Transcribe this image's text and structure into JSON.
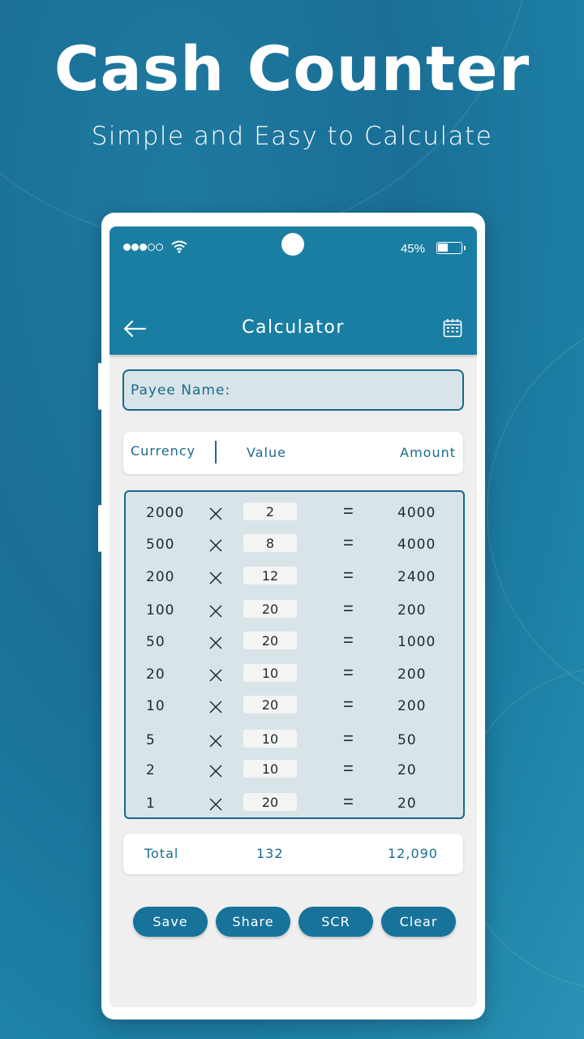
{
  "hero": {
    "title": "Cash Counter",
    "subtitle": "Simple and Easy to Calculate"
  },
  "status_bar": {
    "signal_bars_filled": 3,
    "signal_bars_total": 5,
    "battery_percent_label": "45%",
    "battery_level": 0.45
  },
  "app_bar": {
    "title": "Calculator",
    "back_icon": "arrow-left-icon",
    "action_icon": "calendar-icon"
  },
  "payee": {
    "label": "Payee Name:",
    "value": "",
    "placeholder": ""
  },
  "columns": {
    "currency": "Currency",
    "value": "Value",
    "amount": "Amount"
  },
  "rows": [
    {
      "currency": "2000",
      "qty": "2",
      "amount": "4000"
    },
    {
      "currency": "500",
      "qty": "8",
      "amount": "4000"
    },
    {
      "currency": "200",
      "qty": "12",
      "amount": "2400"
    },
    {
      "currency": "100",
      "qty": "20",
      "amount": "200"
    },
    {
      "currency": "50",
      "qty": "20",
      "amount": "1000"
    },
    {
      "currency": "20",
      "qty": "10",
      "amount": "200"
    },
    {
      "currency": "10",
      "qty": "20",
      "amount": "200"
    },
    {
      "currency": "5",
      "qty": "10",
      "amount": "50"
    },
    {
      "currency": "2",
      "qty": "10",
      "amount": "20"
    },
    {
      "currency": "1",
      "qty": "20",
      "amount": "20"
    }
  ],
  "symbols": {
    "multiply": "×",
    "equals": "="
  },
  "total": {
    "label": "Total",
    "count": "132",
    "amount": "12,090"
  },
  "actions": [
    {
      "label": "Save"
    },
    {
      "label": "Share"
    },
    {
      "label": "SCR"
    },
    {
      "label": "Clear"
    }
  ],
  "colors": {
    "primary": "#1a7ea3",
    "text_accent": "#1a6b8c",
    "table_bg": "#d9e4e8"
  }
}
